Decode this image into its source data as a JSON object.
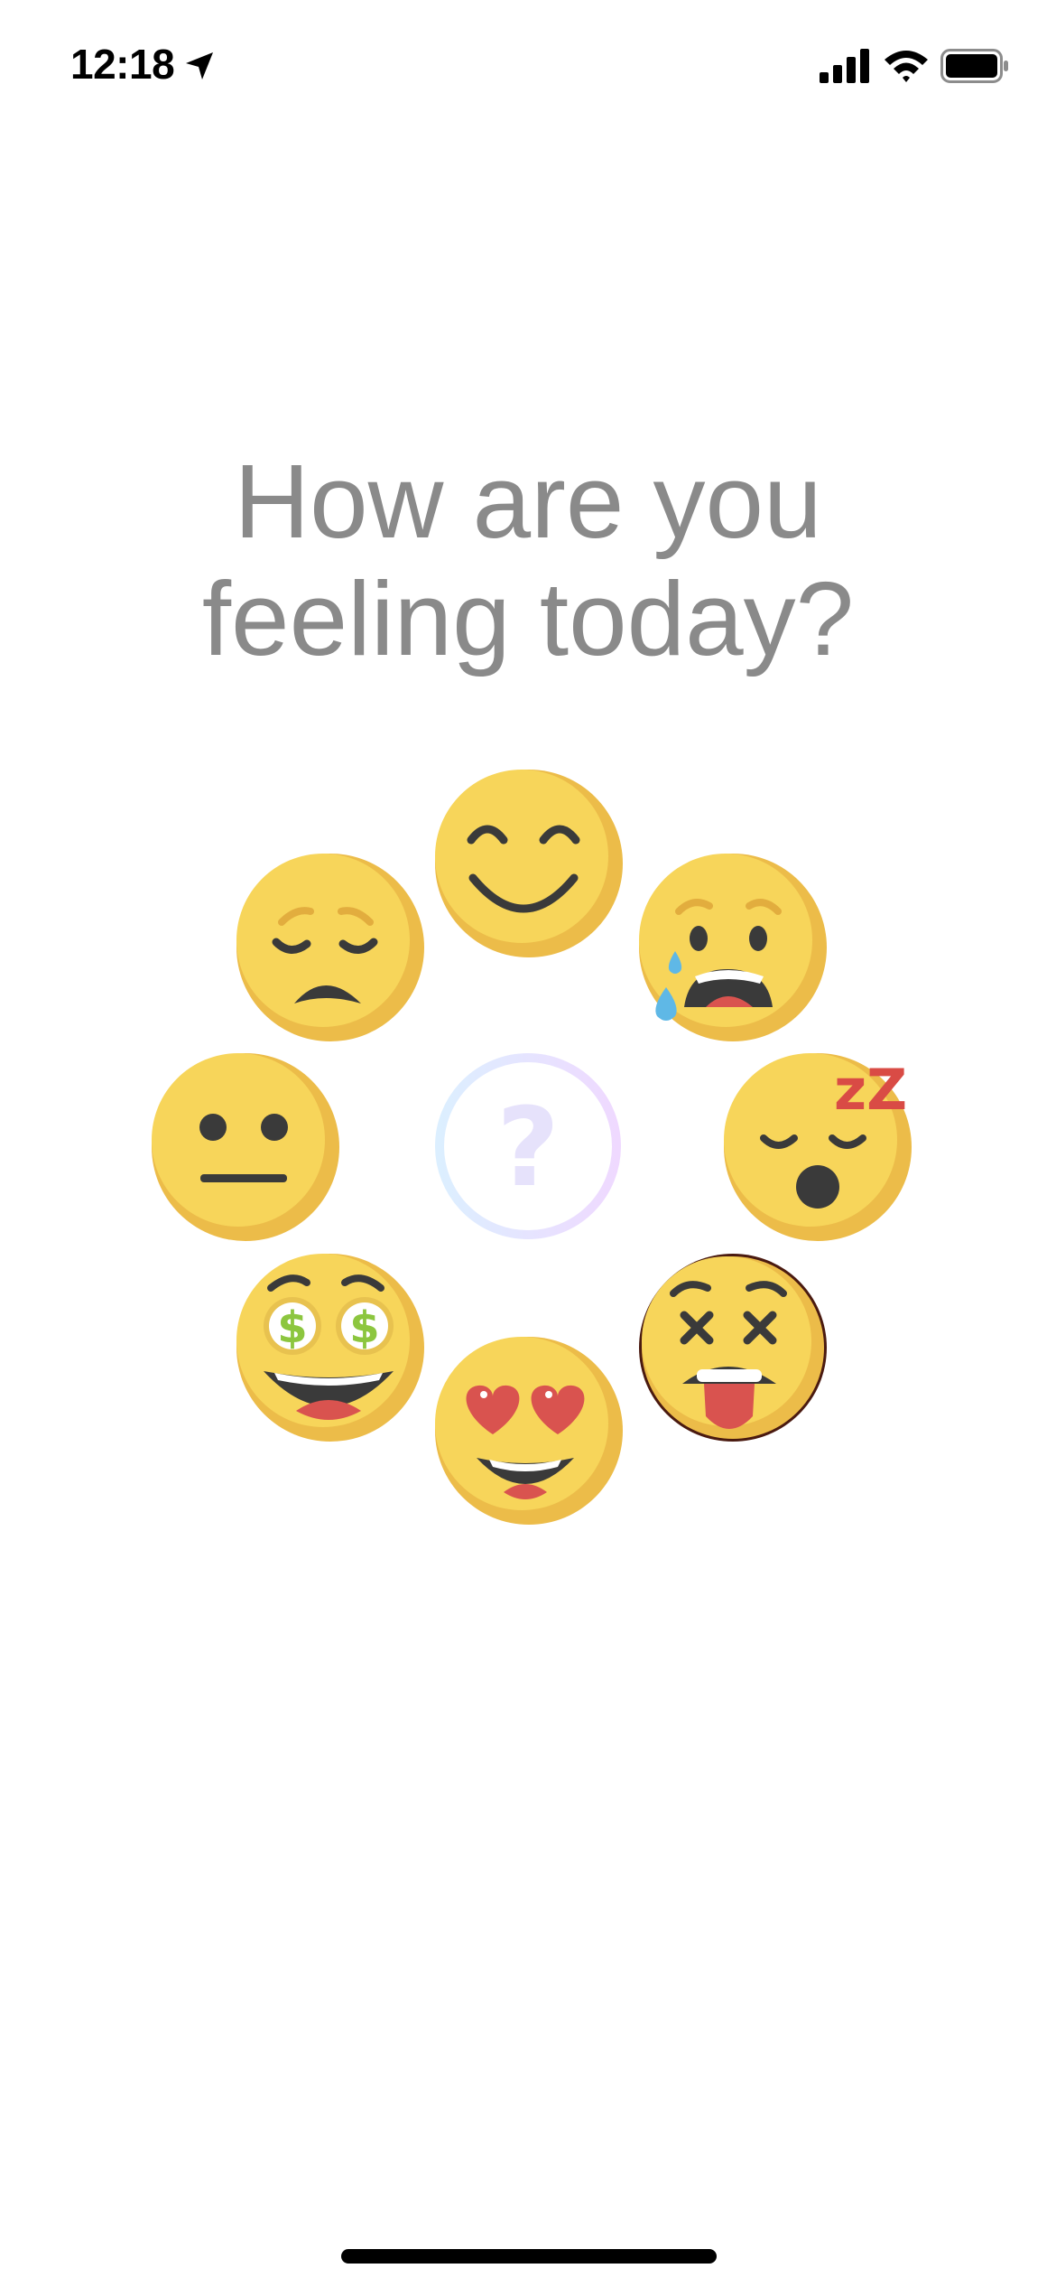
{
  "status_bar": {
    "time": "12:18",
    "icons": [
      "location-arrow-icon",
      "cellular-signal-icon",
      "wifi-icon",
      "battery-icon"
    ]
  },
  "prompt": {
    "line1": "How are you",
    "line2": "feeling today?"
  },
  "center_button": {
    "icon": "question-mark-icon",
    "glyph": "?"
  },
  "moods": [
    {
      "id": "happy",
      "icon": "smiling-face-icon"
    },
    {
      "id": "sad",
      "icon": "sad-face-icon"
    },
    {
      "id": "crying",
      "icon": "crying-face-icon"
    },
    {
      "id": "neutral",
      "icon": "neutral-face-icon"
    },
    {
      "id": "sleepy",
      "icon": "sleepy-face-icon",
      "sleep_text": "zZ"
    },
    {
      "id": "money",
      "icon": "money-eyes-face-icon",
      "currency_symbol": "$"
    },
    {
      "id": "dizzy",
      "icon": "dizzy-tongue-face-icon",
      "selected": true
    },
    {
      "id": "love",
      "icon": "heart-eyes-face-icon"
    }
  ],
  "colors": {
    "face": "#f7d55a",
    "face_shade": "#ecbc49",
    "feature": "#3a3a3a",
    "tongue": "#d9534f",
    "money_green": "#8cc63f",
    "tear": "#5fb8e6",
    "prompt_text": "#8a8a8a",
    "center_gradient_start": "#dcefff",
    "center_gradient_end": "#efd9ff"
  }
}
